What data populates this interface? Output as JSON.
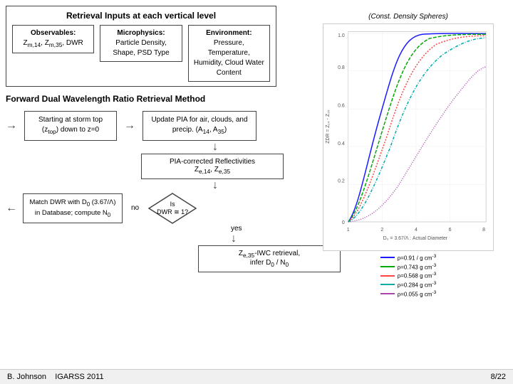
{
  "page": {
    "title": "Retrieval Inputs at each vertical level",
    "forward_method": "Forward Dual Wavelength Ratio Retrieval Method",
    "observables_label": "Observables:",
    "observables_vars": "Z_m,14, Z_m,35, DWR",
    "microphysics_label": "Microphysics:",
    "microphysics_vars": "Particle Density, Shape, PSD Type",
    "environment_label": "Environment:",
    "environment_vars": "Pressure, Temperature, Humidity, Cloud Water Content",
    "const_density": "(Const. Density Spheres)",
    "flow": {
      "step1": "Starting at storm top (z_top) down to z=0",
      "step2": "Update PIA for air, clouds, and precip. (A14, A35)",
      "pia_corrected": "PIA-corrected Reflectivities Z_e,14 Z_e,35",
      "dwr_match": "Match DWR with D0 (3.67/Λ) in Database; compute N0",
      "is_dwr": "Is DWR ≅ 1?",
      "no_label": "no",
      "yes_label": "yes",
      "ze_retrieval": "Z_e,35-IWC retrieval, infer D0 / N0"
    },
    "footer": {
      "author": "B. Johnson",
      "conference": "IGARSS 2011",
      "slide": "8/22"
    },
    "legend": [
      {
        "label": "ρ=0.91 / g cm⁻³",
        "color": "#1a1aff"
      },
      {
        "label": "ρ=0.743 g cm⁻³",
        "color": "#00aa00"
      },
      {
        "label": "ρ=0.568 g cm⁻³",
        "color": "#ff4444"
      },
      {
        "label": "ρ=0.284 g cm⁻³",
        "color": "#00cccc"
      },
      {
        "label": "ρ=0.055 g cm⁻³",
        "color": "#aa44aa"
      }
    ]
  }
}
